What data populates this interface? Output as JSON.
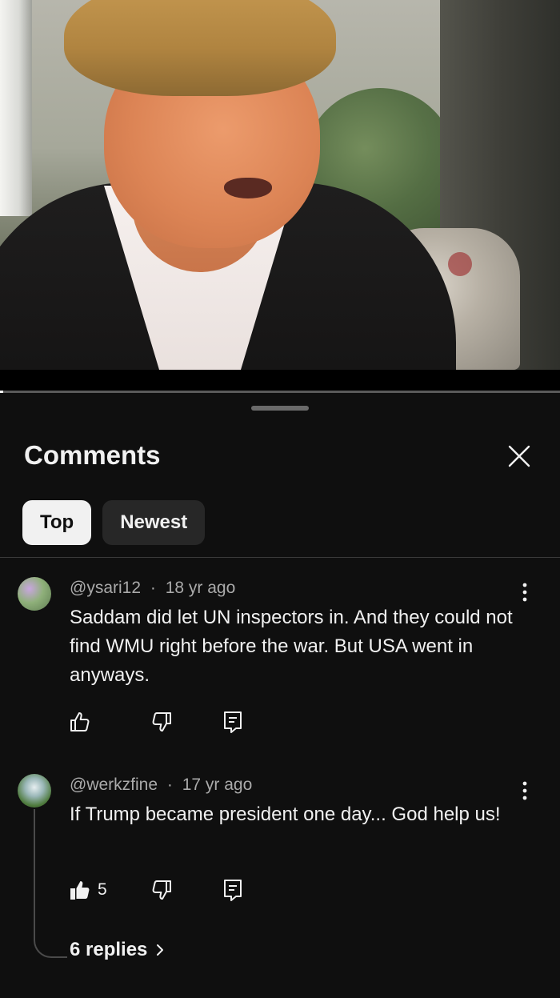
{
  "video": {
    "progress_fraction": 0.005
  },
  "panel": {
    "title": "Comments",
    "close_icon": "close-icon",
    "tabs": [
      {
        "label": "Top",
        "active": true
      },
      {
        "label": "Newest",
        "active": false
      }
    ]
  },
  "comments": [
    {
      "author": "@ysari12",
      "age": "18 yr ago",
      "separator": "·",
      "text": "Saddam did let UN inspectors in. And they could not find WMU right before the war. But USA went in anyways.",
      "like_count": "",
      "liked": false
    },
    {
      "author": "@werkzfine",
      "age": "17 yr ago",
      "separator": "·",
      "text": "If Trump became president one day... God help us!",
      "like_count": "5",
      "liked": true,
      "replies_label": "6 replies"
    }
  ],
  "colors": {
    "background": "#0f0f0f",
    "text_primary": "#f1f1f1",
    "text_secondary": "#aaaaaa",
    "chip_active": "#f1f1f1",
    "chip_inactive": "#272727"
  }
}
